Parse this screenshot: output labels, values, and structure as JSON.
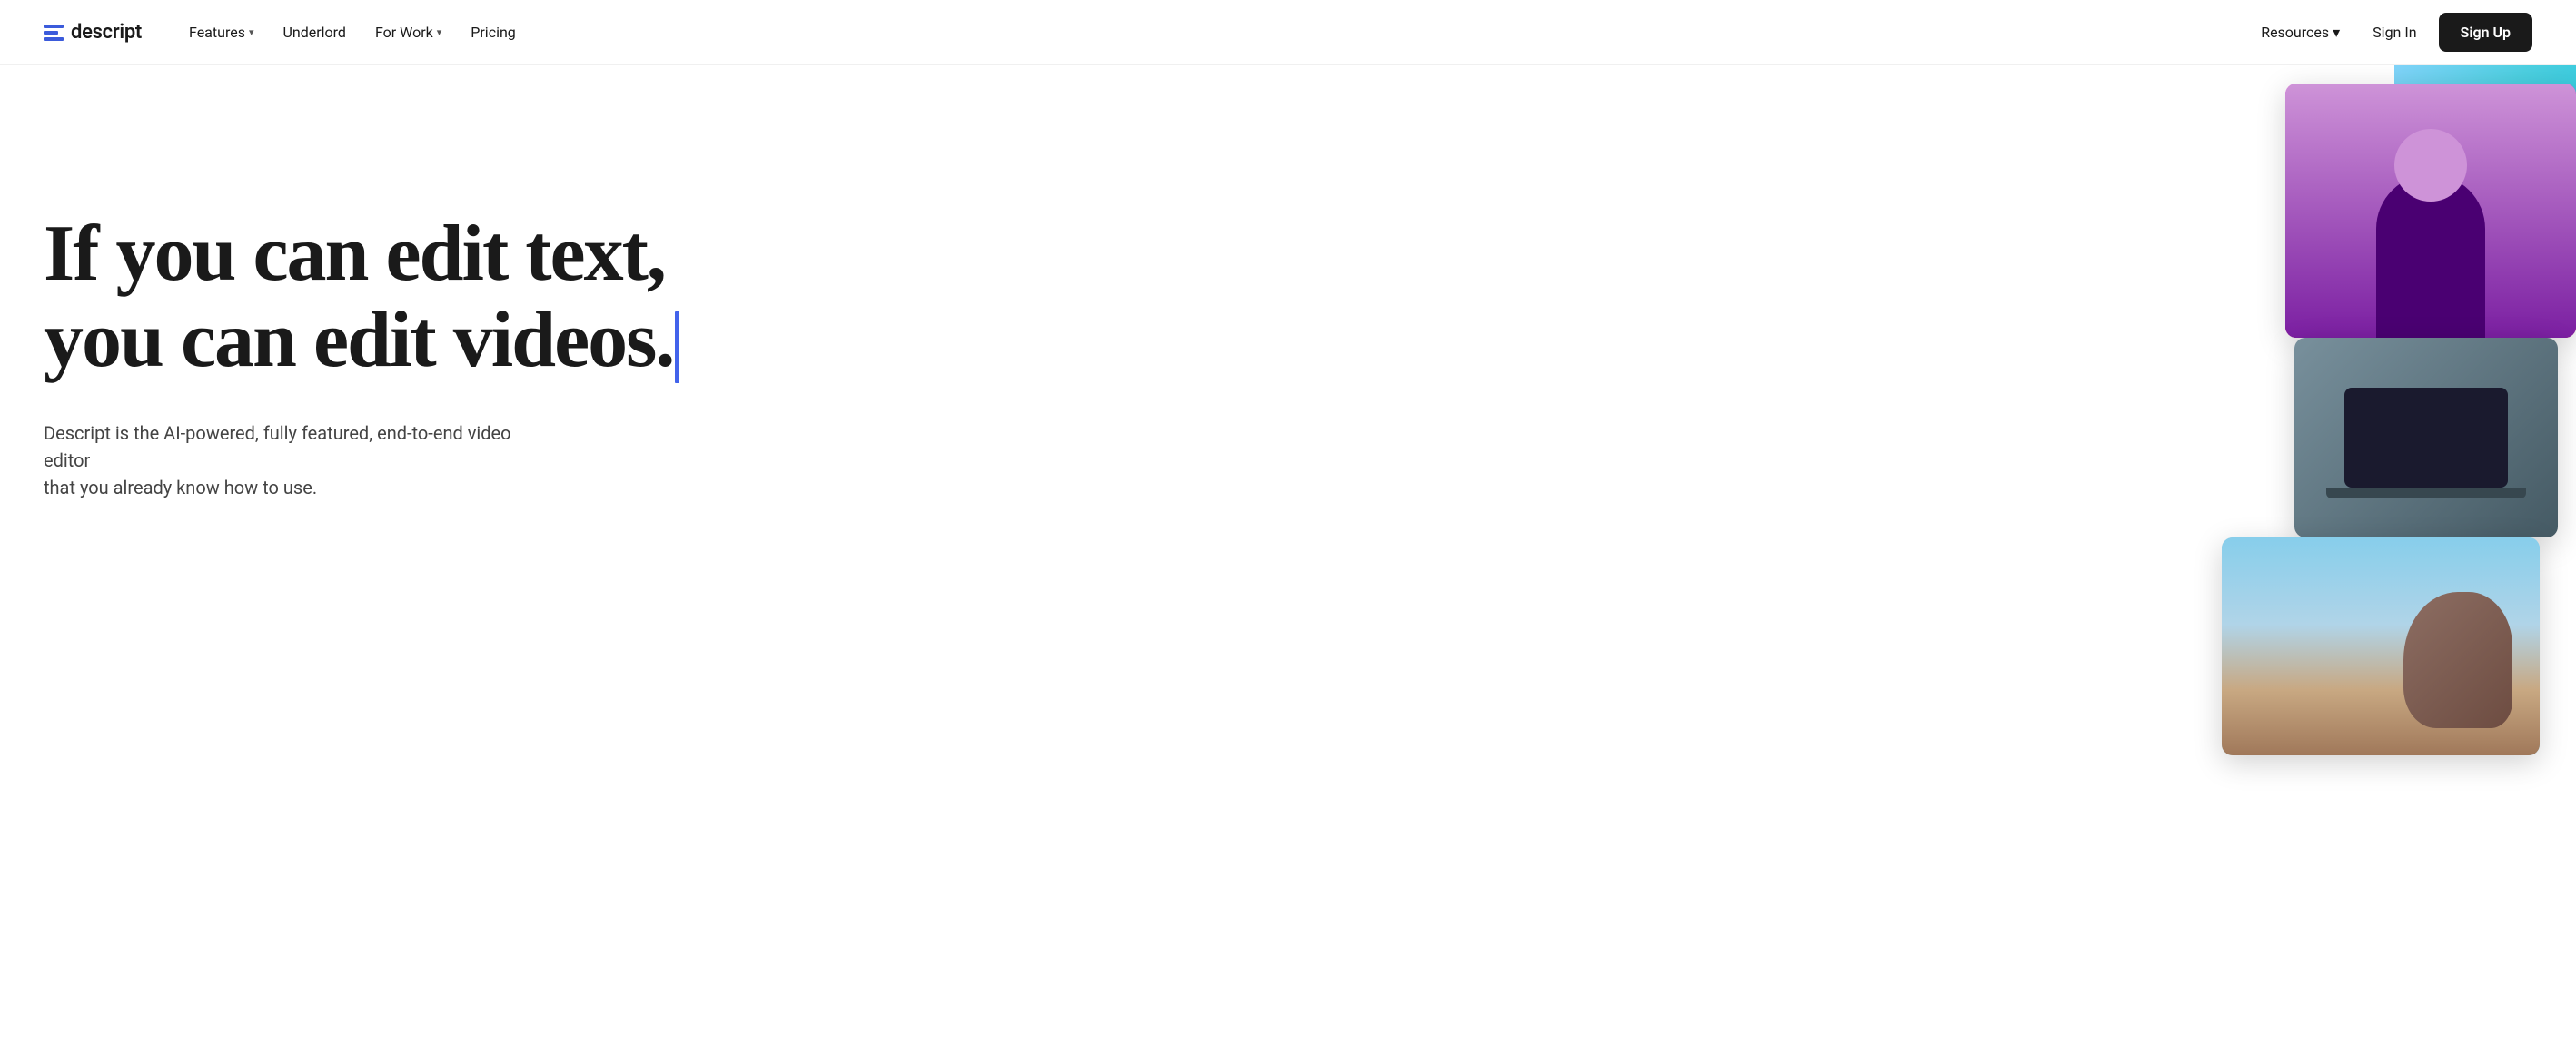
{
  "nav": {
    "logo_text": "descript",
    "links": [
      {
        "label": "Features",
        "has_dropdown": true,
        "id": "features"
      },
      {
        "label": "Underlord",
        "has_dropdown": false,
        "id": "underlord"
      },
      {
        "label": "For Work",
        "has_dropdown": true,
        "id": "for-work"
      },
      {
        "label": "Pricing",
        "has_dropdown": false,
        "id": "pricing"
      }
    ],
    "right_links": [
      {
        "label": "Resources",
        "has_dropdown": true,
        "id": "resources"
      },
      {
        "label": "Sign In",
        "has_dropdown": false,
        "id": "sign-in"
      }
    ],
    "cta_label": "Sign Up"
  },
  "hero": {
    "headline_line1": "If you can edit text,",
    "headline_line2": "you can edit videos.",
    "subtext_line1": "Descript is the AI-powered, fully featured, end-to-end video editor",
    "subtext_line2": "that you already know how to use."
  }
}
